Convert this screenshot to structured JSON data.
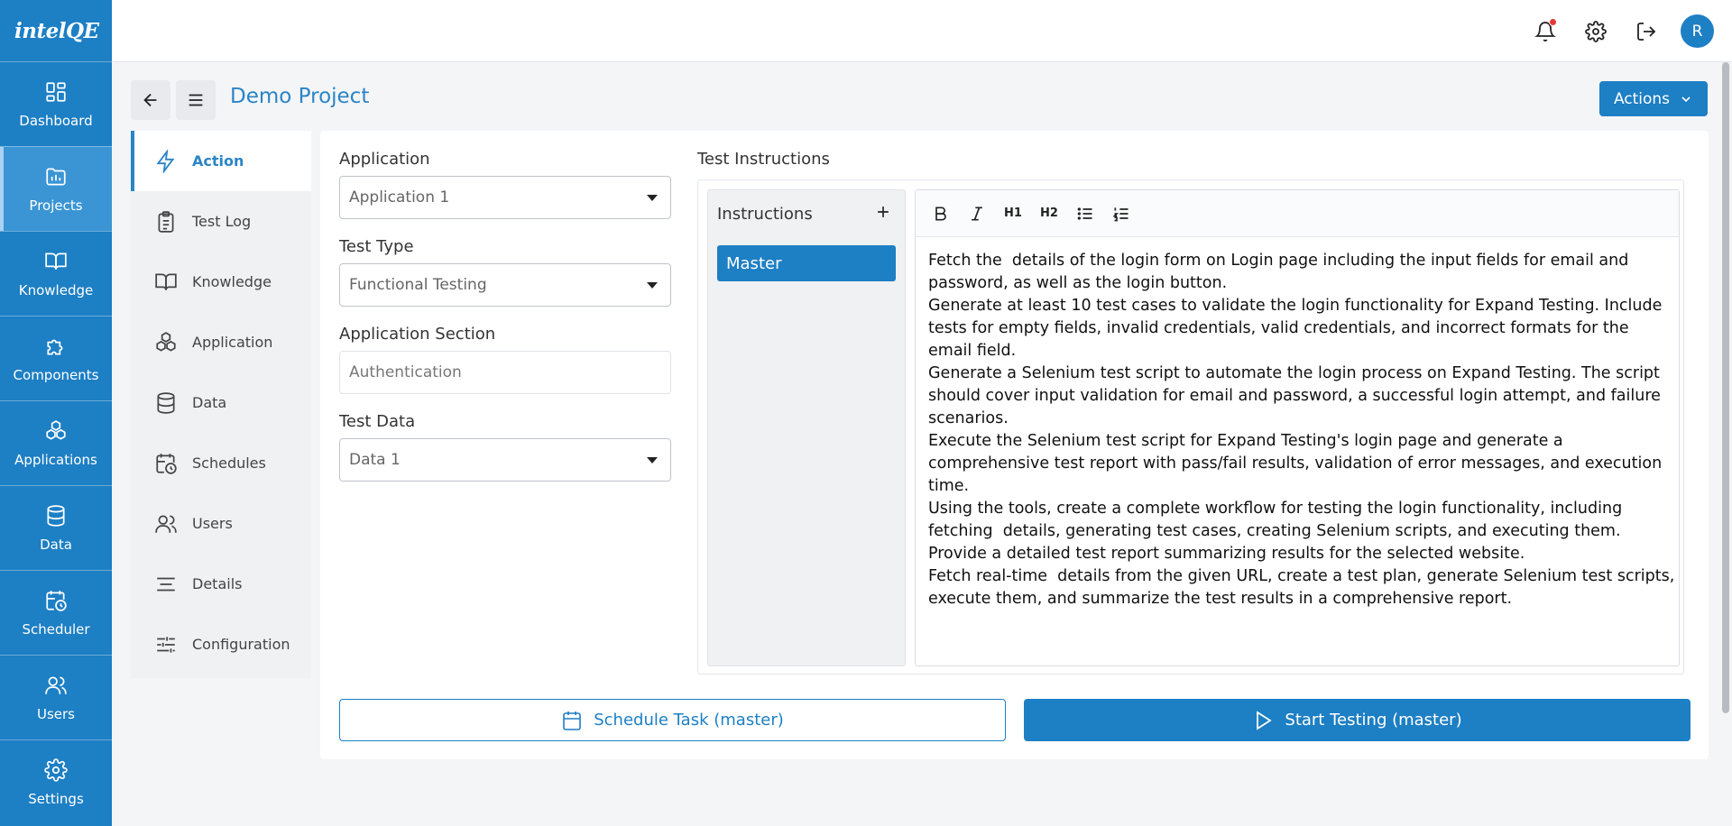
{
  "app": {
    "logo": "intelQE"
  },
  "sidebar": {
    "items": [
      {
        "label": "Dashboard",
        "icon": "dashboard-icon"
      },
      {
        "label": "Projects",
        "icon": "projects-icon",
        "active": true
      },
      {
        "label": "Knowledge",
        "icon": "book-icon"
      },
      {
        "label": "Components",
        "icon": "puzzle-icon"
      },
      {
        "label": "Applications",
        "icon": "applications-icon"
      },
      {
        "label": "Data",
        "icon": "database-icon"
      },
      {
        "label": "Scheduler",
        "icon": "calendar-clock-icon"
      },
      {
        "label": "Users",
        "icon": "users-icon"
      },
      {
        "label": "Settings",
        "icon": "gear-icon"
      }
    ]
  },
  "topbar": {
    "avatar_initial": "R"
  },
  "header": {
    "title": "Demo Project",
    "actions_label": "Actions"
  },
  "tabs": [
    {
      "label": "Action",
      "icon": "lightning-icon",
      "active": true
    },
    {
      "label": "Test Log",
      "icon": "clipboard-icon"
    },
    {
      "label": "Knowledge",
      "icon": "book-icon"
    },
    {
      "label": "Application",
      "icon": "applications-icon"
    },
    {
      "label": "Data",
      "icon": "database-icon"
    },
    {
      "label": "Schedules",
      "icon": "calendar-clock-icon"
    },
    {
      "label": "Users",
      "icon": "users-icon"
    },
    {
      "label": "Details",
      "icon": "align-icon"
    },
    {
      "label": "Configuration",
      "icon": "sliders-icon"
    }
  ],
  "form": {
    "application": {
      "label": "Application",
      "value": "Application 1"
    },
    "test_type": {
      "label": "Test Type",
      "value": "Functional Testing"
    },
    "app_section": {
      "label": "Application Section",
      "value": "Authentication"
    },
    "test_data": {
      "label": "Test Data",
      "value": "Data 1"
    }
  },
  "instructions": {
    "title": "Test Instructions",
    "list_header": "Instructions",
    "items": [
      "Master"
    ],
    "toolbar": [
      "bold",
      "italic",
      "H1",
      "H2",
      "bullet-list",
      "numbered-list"
    ],
    "editor_lines": [
      "Fetch the  details of the login form on Login page including the input fields for email and",
      "password, as well as the login button.",
      "Generate at least 10 test cases to validate the login functionality for Expand Testing. Include",
      "tests for empty fields, invalid credentials, valid credentials, and incorrect formats for the",
      "email field.",
      "Generate a Selenium test script to automate the login process on Expand Testing. The script",
      "should cover input validation for email and password, a successful login attempt, and failure",
      "scenarios.",
      "Execute the Selenium test script for Expand Testing's login page and generate a",
      "comprehensive test report with pass/fail results, validation of error messages, and execution",
      "time.",
      "Using the tools, create a complete workflow for testing the login functionality, including",
      "fetching  details, generating test cases, creating Selenium scripts, and executing them.",
      "Provide a detailed test report summarizing results for the selected website.",
      "Fetch real-time  details from the given URL, create a test plan, generate Selenium test scripts,",
      "execute them, and summarize the test results in a comprehensive report."
    ]
  },
  "buttons": {
    "schedule": "Schedule Task (master)",
    "start": "Start Testing (master)"
  },
  "colors": {
    "primary": "#1d7fc4",
    "active_nav": "#3b95d4",
    "title": "#2a84c6"
  }
}
